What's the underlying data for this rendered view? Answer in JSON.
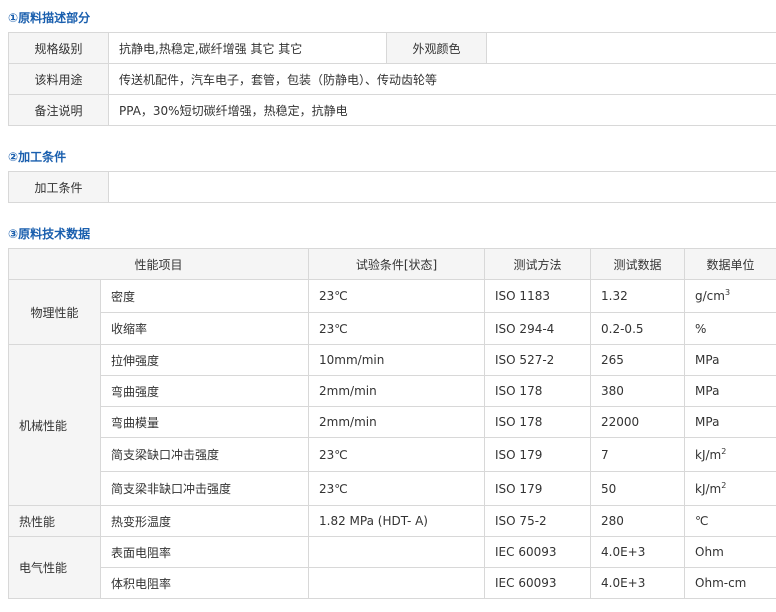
{
  "section1": {
    "title": "①原料描述部分",
    "rows": [
      {
        "label": "规格级别",
        "value": "抗静电,热稳定,碳纤增强 其它 其它",
        "label2": "外观颜色",
        "value2": ""
      },
      {
        "label": "该料用途",
        "value": "传送机配件，汽车电子，套管，包装（防静电）、传动齿轮等"
      },
      {
        "label": "备注说明",
        "value": "PPA，30%短切碳纤增强，热稳定，抗静电"
      }
    ]
  },
  "section2": {
    "title": "②加工条件",
    "rows": [
      {
        "label": "加工条件",
        "value": ""
      }
    ]
  },
  "section3": {
    "title": "③原料技术数据",
    "headers": [
      "性能项目",
      "试验条件[状态]",
      "测试方法",
      "测试数据",
      "数据单位"
    ],
    "groups": [
      {
        "category": "物理性能",
        "rows": [
          {
            "item": "密度",
            "condition": "23℃",
            "method": "ISO 1183",
            "value": "1.32",
            "unit": "g/cm",
            "unit_sup": "3"
          },
          {
            "item": "收缩率",
            "condition": "23℃",
            "method": "ISO 294-4",
            "value": "0.2-0.5",
            "unit": "%"
          }
        ]
      },
      {
        "category": "机械性能",
        "rows": [
          {
            "item": "拉伸强度",
            "condition": "10mm/min",
            "method": "ISO 527-2",
            "value": "265",
            "unit": "MPa"
          },
          {
            "item": "弯曲强度",
            "condition": "2mm/min",
            "method": "ISO 178",
            "value": "380",
            "unit": "MPa"
          },
          {
            "item": "弯曲模量",
            "condition": "2mm/min",
            "method": "ISO 178",
            "value": "22000",
            "unit": "MPa"
          },
          {
            "item": "简支梁缺口冲击强度",
            "condition": "23℃",
            "method": "ISO 179",
            "value": "7",
            "unit": "kJ/m",
            "unit_sup": "2"
          },
          {
            "item": "简支梁非缺口冲击强度",
            "condition": "23℃",
            "method": "ISO 179",
            "value": "50",
            "unit": "kJ/m",
            "unit_sup": "2"
          }
        ]
      },
      {
        "category": "热性能",
        "rows": [
          {
            "item": "热变形温度",
            "condition": "1.82 MPa (HDT- A)",
            "method": "ISO 75-2",
            "value": "280",
            "unit": "℃"
          }
        ]
      },
      {
        "category": "电气性能",
        "rows": [
          {
            "item": "表面电阻率",
            "condition": "",
            "method": "IEC 60093",
            "value": "4.0E+3",
            "unit": "Ohm"
          },
          {
            "item": "体积电阻率",
            "condition": "",
            "method": "IEC 60093",
            "value": "4.0E+3",
            "unit": "Ohm-cm"
          }
        ]
      }
    ]
  }
}
